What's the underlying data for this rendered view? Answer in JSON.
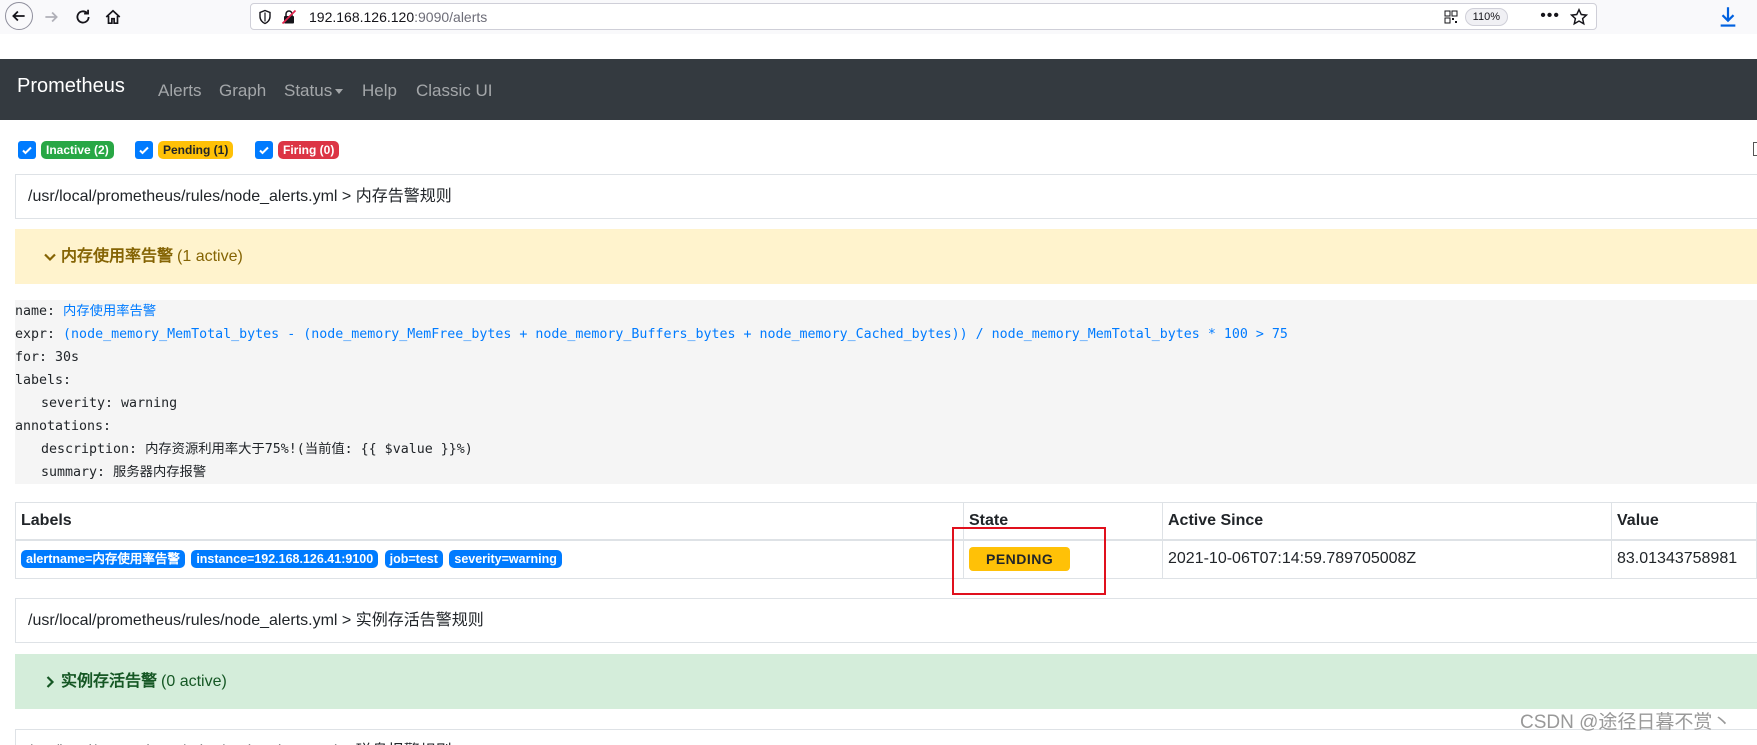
{
  "browser": {
    "url_host": "192.168.126.120",
    "url_rest": ":9090/alerts",
    "zoom": "110%",
    "more_label": "•••"
  },
  "navbar": {
    "brand": "Prometheus",
    "links": [
      "Alerts",
      "Graph",
      "Status",
      "Help",
      "Classic UI"
    ]
  },
  "filters": [
    {
      "label": "Inactive (2)",
      "checked": true,
      "color": "#28a745"
    },
    {
      "label": "Pending (1)",
      "checked": true,
      "color": "#ffc107"
    },
    {
      "label": "Firing (0)",
      "checked": true,
      "color": "#dc3545"
    }
  ],
  "groups": [
    {
      "path": "/usr/local/prometheus/rules/node_alerts.yml > 内存告警规则",
      "rule": {
        "name": "内存使用率告警",
        "count": "(1 active)",
        "def": {
          "name_key": "name: ",
          "name_val": "内存使用率告警",
          "expr_key": "expr: ",
          "expr_val": "(node_memory_MemTotal_bytes - (node_memory_MemFree_bytes + node_memory_Buffers_bytes + node_memory_Cached_bytes)) / node_memory_MemTotal_bytes * 100 > 75",
          "for": "for: 30s",
          "labels": "labels:",
          "severity": "severity: warning",
          "annotations": "annotations:",
          "description": "description: 内存资源利用率大于75%!(当前值: {{ $value }}%)",
          "summary": "summary: 服务器内存报警"
        }
      },
      "table": {
        "headers": [
          "Labels",
          "State",
          "Active Since",
          "Value"
        ],
        "row": {
          "labels": [
            "alertname=内存使用率告警",
            "instance=192.168.126.41:9100",
            "job=test",
            "severity=warning"
          ],
          "state": "PENDING",
          "active_since": "2021-10-06T07:14:59.789705008Z",
          "value": "83.01343758981"
        }
      }
    },
    {
      "path": "/usr/local/prometheus/rules/node_alerts.yml > 实例存活告警规则",
      "rule": {
        "name": "实例存活告警",
        "count": "(0 active)"
      }
    },
    {
      "path": "/usr/local/prometheus/rules/node_alerts.yml > 磁盘报警规则"
    }
  ],
  "watermark": "CSDN @途径日暮不赏丶",
  "colors": {
    "navbar": "#343a40",
    "pending_bg": "#fff3cd",
    "inactive_bg": "#d4edda",
    "badge_blue": "#007bff",
    "highlight": "#e0101d"
  }
}
